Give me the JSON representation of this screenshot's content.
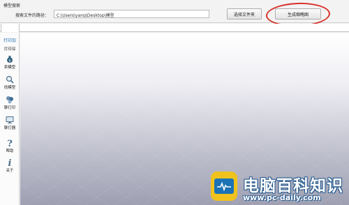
{
  "search_group": {
    "title": "模型搜索",
    "path_label": "搜索文件的路径：",
    "path_value": "C:\\Users\\yang\\Desktop\\模型",
    "choose_folder_label": "选择文件夹",
    "generate_thumbnail_label": "生成缩略图"
  },
  "sidebar": {
    "heading": "打印加",
    "items": [
      {
        "label": "打印深",
        "icon": "printer-icon"
      },
      {
        "label": "卖模型",
        "icon": "money-bag-icon"
      },
      {
        "label": "找模型",
        "icon": "magnifier-icon"
      },
      {
        "label": "聊打印",
        "icon": "chat-icon"
      },
      {
        "label": "聊打器",
        "icon": "monitor-icon"
      },
      {
        "label": "帮助",
        "icon": "question-icon"
      },
      {
        "label": "关于",
        "icon": "info-icon"
      }
    ]
  },
  "watermark": {
    "title": "电脑百科知识",
    "url": "www.pc-daily.com"
  },
  "colors": {
    "accent": "#2a74b8",
    "annotation_circle": "#d8322b",
    "watermark_logo": "#f0c21d",
    "watermark_screen": "#1b73b5"
  }
}
